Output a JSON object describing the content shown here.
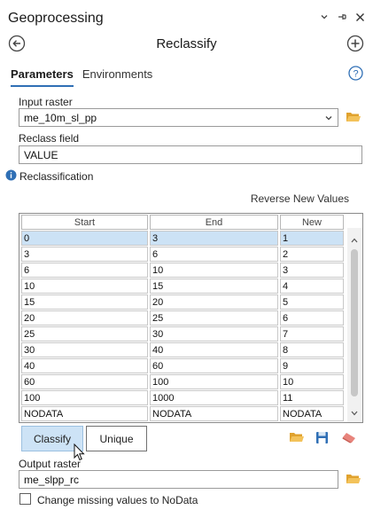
{
  "pane": {
    "title": "Geoprocessing"
  },
  "tool": {
    "name": "Reclassify"
  },
  "tabs": [
    {
      "label": "Parameters",
      "active": true
    },
    {
      "label": "Environments",
      "active": false
    }
  ],
  "params": {
    "input_raster": {
      "label": "Input raster",
      "value": "me_10m_sl_pp"
    },
    "reclass_field": {
      "label": "Reclass field",
      "value": "VALUE"
    },
    "reclassification": {
      "label": "Reclassification"
    },
    "reverse_label": "Reverse New Values",
    "output_raster": {
      "label": "Output raster",
      "value": "me_slpp_rc"
    },
    "missing_nodata": {
      "label": "Change missing values to NoData",
      "checked": false
    }
  },
  "table": {
    "columns": [
      "Start",
      "End",
      "New"
    ],
    "rows": [
      [
        "0",
        "3",
        "1"
      ],
      [
        "3",
        "6",
        "2"
      ],
      [
        "6",
        "10",
        "3"
      ],
      [
        "10",
        "15",
        "4"
      ],
      [
        "15",
        "20",
        "5"
      ],
      [
        "20",
        "25",
        "6"
      ],
      [
        "25",
        "30",
        "7"
      ],
      [
        "30",
        "40",
        "8"
      ],
      [
        "40",
        "60",
        "9"
      ],
      [
        "60",
        "100",
        "10"
      ],
      [
        "100",
        "1000",
        "11"
      ],
      [
        "NODATA",
        "NODATA",
        "NODATA"
      ]
    ],
    "selected_row": 0
  },
  "buttons": {
    "classify": "Classify",
    "unique": "Unique"
  },
  "colors": {
    "accent": "#2f6fb5",
    "selected_row": "#cce2f5",
    "folder": "#e0a22e",
    "save": "#2f6fb5",
    "eraser": "#e8847c"
  }
}
